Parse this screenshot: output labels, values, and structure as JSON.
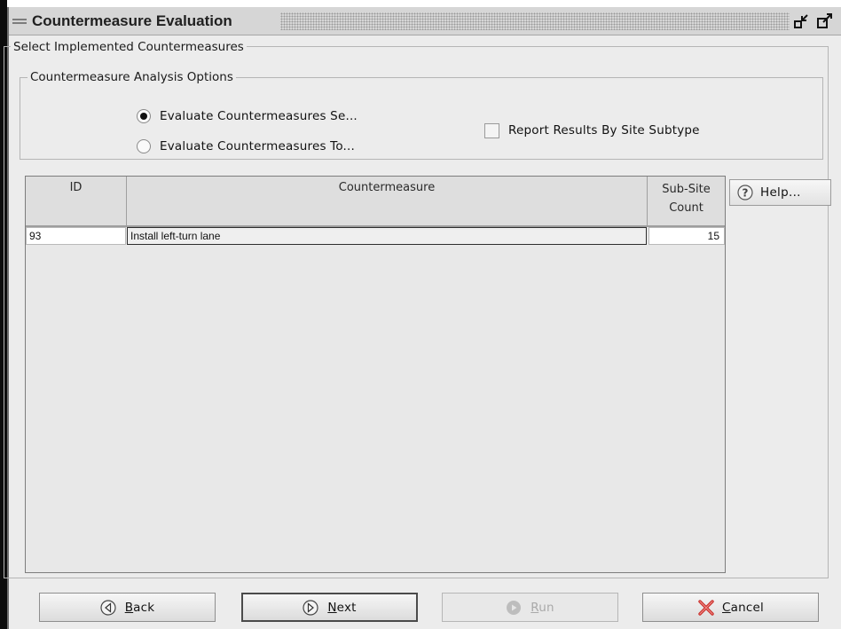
{
  "window": {
    "title": "Countermeasure Evaluation",
    "minimize_icon": "restore-down-icon",
    "maximize_icon": "maximize-icon"
  },
  "outer_group": {
    "title": "Select Implemented Countermeasures"
  },
  "options_group": {
    "title": "Countermeasure Analysis Options",
    "radio_options": [
      {
        "label": "Evaluate Countermeasures Se...",
        "checked": true
      },
      {
        "label": "Evaluate Countermeasures To...",
        "checked": false
      }
    ],
    "checkbox": {
      "label": "Report Results By Site Subtype",
      "checked": false
    }
  },
  "table": {
    "columns": [
      {
        "label": "ID"
      },
      {
        "label": "Countermeasure"
      },
      {
        "label_line1": "Sub-Site",
        "label_line2": "Count"
      }
    ],
    "rows": [
      {
        "id": "93",
        "countermeasure": "Install left-turn lane",
        "count": "15"
      }
    ]
  },
  "help_button": {
    "label": "Help...",
    "mnemonic": "H",
    "rest": "elp...",
    "icon": "help-question-icon"
  },
  "footer": {
    "back": {
      "mnemonic": "B",
      "rest": "ack",
      "icon": "back-arrow-icon",
      "enabled": true
    },
    "next": {
      "mnemonic": "N",
      "rest": "ext",
      "icon": "next-arrow-icon",
      "enabled": true
    },
    "run": {
      "mnemonic": "R",
      "rest": "un",
      "icon": "run-icon",
      "enabled": false
    },
    "cancel": {
      "mnemonic": "C",
      "rest": "ancel",
      "icon": "cancel-x-icon",
      "enabled": true
    }
  },
  "colors": {
    "frame_bg": "#ececec",
    "cancel_icon": "#d9534f",
    "disabled_text": "#a9a9a9"
  }
}
